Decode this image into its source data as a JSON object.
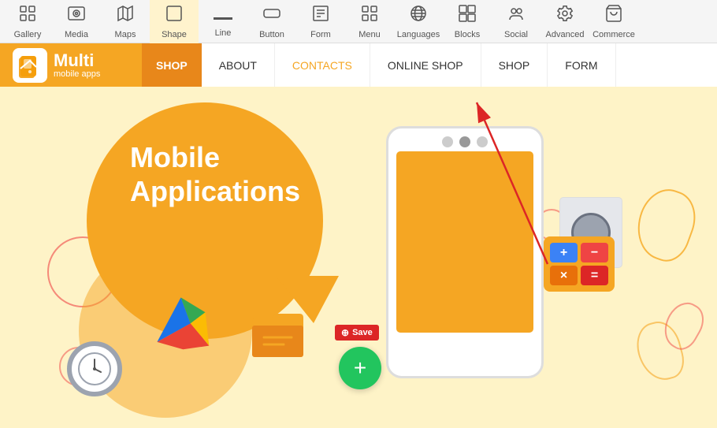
{
  "toolbar": {
    "items": [
      {
        "id": "gallery",
        "label": "Gallery",
        "icon": "⊞"
      },
      {
        "id": "media",
        "label": "Media",
        "icon": "▶"
      },
      {
        "id": "maps",
        "label": "Maps",
        "icon": "🗺"
      },
      {
        "id": "shape",
        "label": "Shape",
        "icon": "⬜"
      },
      {
        "id": "line",
        "label": "Line",
        "icon": "─"
      },
      {
        "id": "button",
        "label": "Button",
        "icon": "⊡"
      },
      {
        "id": "form",
        "label": "Form",
        "icon": "▤"
      },
      {
        "id": "menu",
        "label": "Menu",
        "icon": "⊞"
      },
      {
        "id": "languages",
        "label": "Languages",
        "icon": "🌐"
      },
      {
        "id": "blocks",
        "label": "Blocks",
        "icon": "⊞"
      },
      {
        "id": "social",
        "label": "Social",
        "icon": "👥"
      },
      {
        "id": "advanced",
        "label": "Advanced",
        "icon": "⚙"
      },
      {
        "id": "commerce",
        "label": "Commerce",
        "icon": "🛒"
      }
    ]
  },
  "navbar": {
    "logo_main": "Multi",
    "logo_sub": "mobile apps",
    "shop_btn": "SHOP",
    "links": [
      "ABOUT",
      "CONTACTS",
      "ONLINE SHOP",
      "SHOP",
      "FORM"
    ]
  },
  "hero": {
    "title_line1": "Mobile",
    "title_line2": "Applications"
  },
  "save_badge": "Save",
  "plus_btn": "+",
  "calc": {
    "btns": [
      "+",
      "−",
      "×",
      "="
    ]
  }
}
